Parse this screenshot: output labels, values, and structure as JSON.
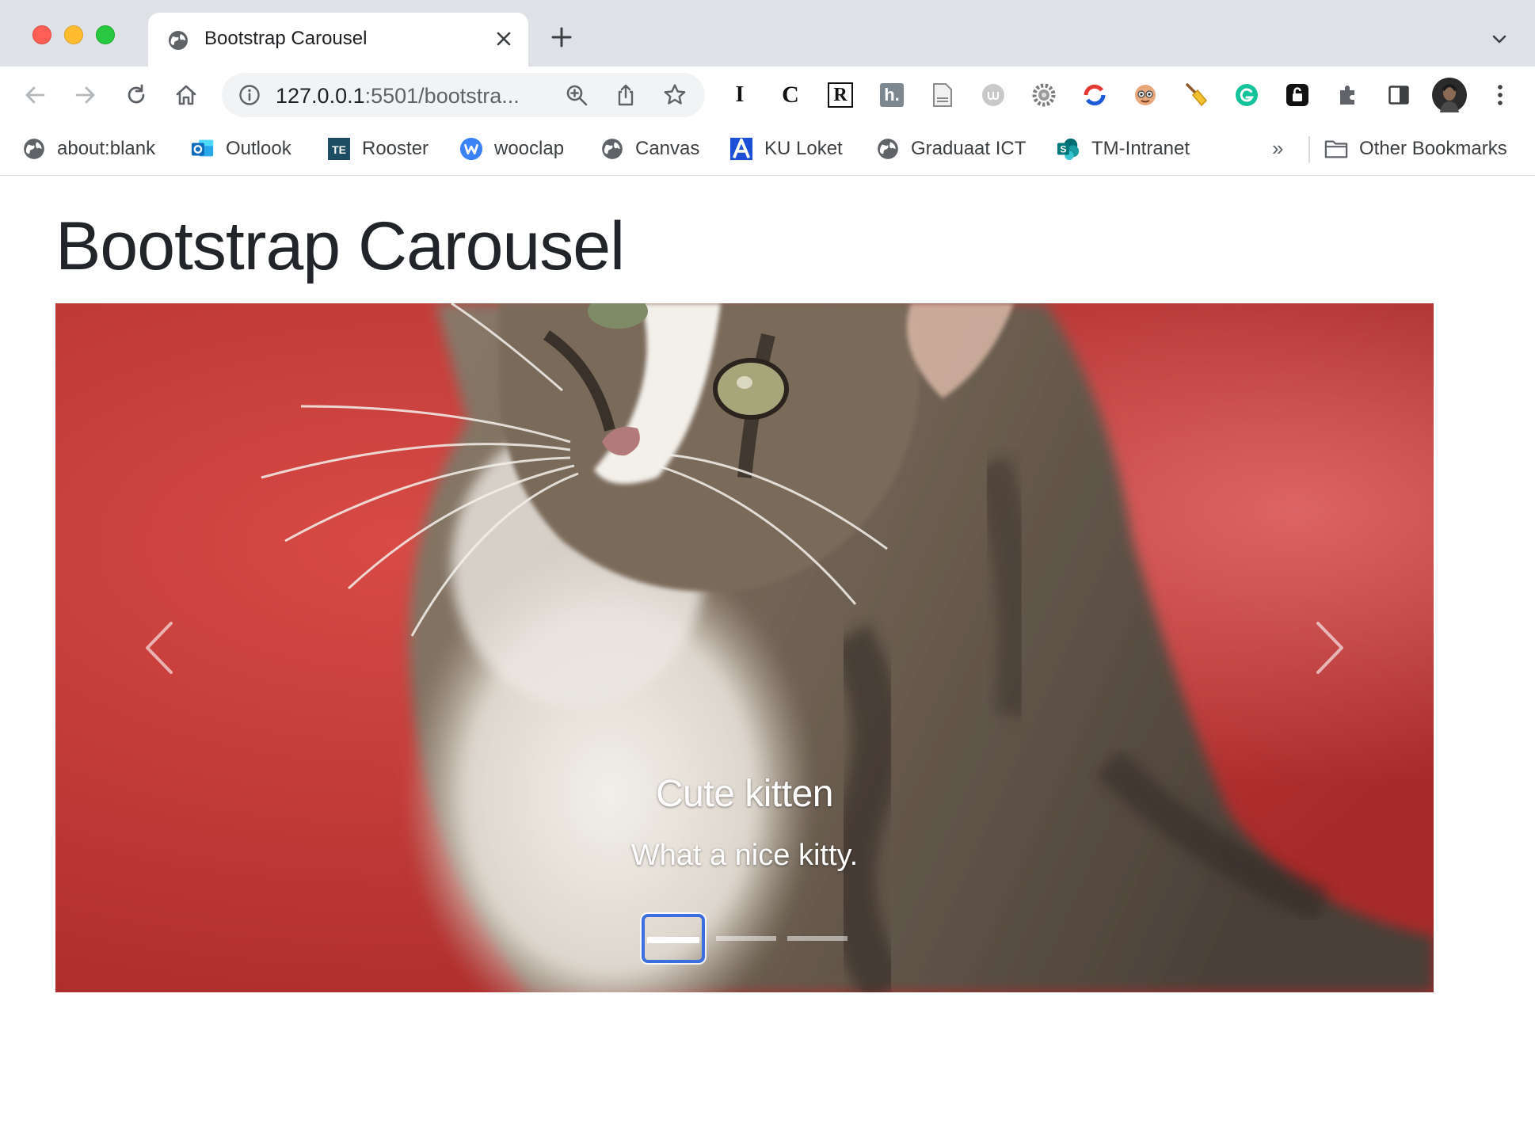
{
  "browser": {
    "tab": {
      "title": "Bootstrap Carousel",
      "favicon": "globe-icon"
    },
    "toolbar": {
      "url_host": "127.0.0.1",
      "url_rest": ":5501/bootstra..."
    },
    "bookmarks": [
      {
        "label": "about:blank",
        "icon": "globe-icon"
      },
      {
        "label": "Outlook",
        "icon": "outlook-icon"
      },
      {
        "label": "Rooster",
        "icon": "te-icon"
      },
      {
        "label": "wooclap",
        "icon": "wooclap-icon"
      },
      {
        "label": "Canvas",
        "icon": "globe-icon"
      },
      {
        "label": "KU Loket",
        "icon": "ku-icon"
      },
      {
        "label": "Graduaat ICT",
        "icon": "globe-icon"
      },
      {
        "label": "TM-Intranet",
        "icon": "sharepoint-icon"
      }
    ],
    "bookmarks_overflow": "»",
    "other_bookmarks": "Other Bookmarks",
    "extensions": {
      "ext1": "I",
      "ext2": "C",
      "ext3": "R",
      "ext4": "h."
    }
  },
  "page": {
    "title": "Bootstrap Carousel",
    "carousel": {
      "caption_title": "Cute kitten",
      "caption_text": "What a nice kitty.",
      "slide_count": 3,
      "active_index": 0
    }
  },
  "colors": {
    "chrome_bg": "#dee1e6",
    "accent_focus": "#3b6fe0",
    "slide_background": "#c8383a"
  }
}
